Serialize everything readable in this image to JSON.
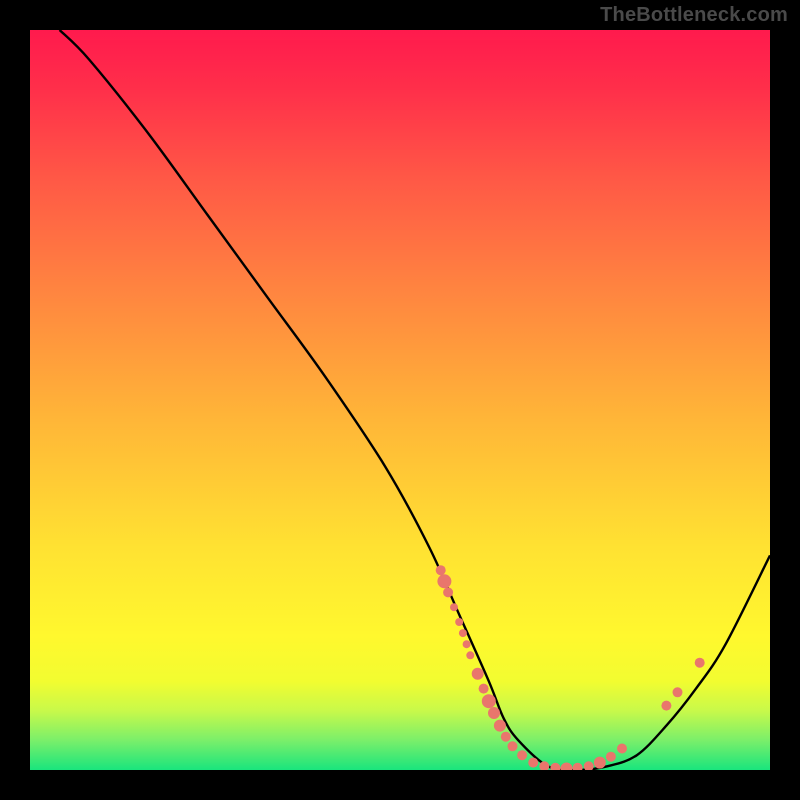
{
  "watermark": "TheBottleneck.com",
  "chart_data": {
    "type": "line",
    "title": "",
    "xlabel": "",
    "ylabel": "",
    "xlim": [
      0,
      100
    ],
    "ylim": [
      0,
      100
    ],
    "series": [
      {
        "name": "curve",
        "x": [
          4,
          8,
          16,
          24,
          32,
          40,
          48,
          54,
          58,
          62,
          64,
          66,
          70,
          74,
          78,
          82,
          86,
          90,
          94,
          100
        ],
        "y": [
          100,
          96,
          86,
          75,
          64,
          53,
          41,
          30,
          21,
          12,
          7,
          4,
          0.5,
          0,
          0.5,
          2,
          6,
          11,
          17,
          29
        ]
      }
    ],
    "markers": [
      {
        "x": 55.5,
        "y": 27,
        "r": 5
      },
      {
        "x": 56.0,
        "y": 25.5,
        "r": 7
      },
      {
        "x": 56.5,
        "y": 24,
        "r": 5
      },
      {
        "x": 57.3,
        "y": 22,
        "r": 4
      },
      {
        "x": 58.0,
        "y": 20,
        "r": 4
      },
      {
        "x": 58.5,
        "y": 18.5,
        "r": 4
      },
      {
        "x": 59.0,
        "y": 17,
        "r": 4
      },
      {
        "x": 59.5,
        "y": 15.5,
        "r": 4
      },
      {
        "x": 60.5,
        "y": 13,
        "r": 6
      },
      {
        "x": 61.3,
        "y": 11,
        "r": 5
      },
      {
        "x": 62.0,
        "y": 9.3,
        "r": 7
      },
      {
        "x": 62.7,
        "y": 7.7,
        "r": 6
      },
      {
        "x": 63.5,
        "y": 6.0,
        "r": 6
      },
      {
        "x": 64.3,
        "y": 4.5,
        "r": 5
      },
      {
        "x": 65.2,
        "y": 3.2,
        "r": 5
      },
      {
        "x": 66.5,
        "y": 2.0,
        "r": 5
      },
      {
        "x": 68.0,
        "y": 1.0,
        "r": 5
      },
      {
        "x": 69.5,
        "y": 0.5,
        "r": 5
      },
      {
        "x": 71.0,
        "y": 0.3,
        "r": 5
      },
      {
        "x": 72.5,
        "y": 0.2,
        "r": 6
      },
      {
        "x": 74.0,
        "y": 0.3,
        "r": 5
      },
      {
        "x": 75.5,
        "y": 0.5,
        "r": 5
      },
      {
        "x": 77.0,
        "y": 1.0,
        "r": 6
      },
      {
        "x": 78.5,
        "y": 1.8,
        "r": 5
      },
      {
        "x": 80.0,
        "y": 2.9,
        "r": 5
      },
      {
        "x": 86.0,
        "y": 8.7,
        "r": 5
      },
      {
        "x": 87.5,
        "y": 10.5,
        "r": 5
      },
      {
        "x": 90.5,
        "y": 14.5,
        "r": 5
      }
    ],
    "marker_color": "#e9766c",
    "curve_color": "#000000"
  }
}
